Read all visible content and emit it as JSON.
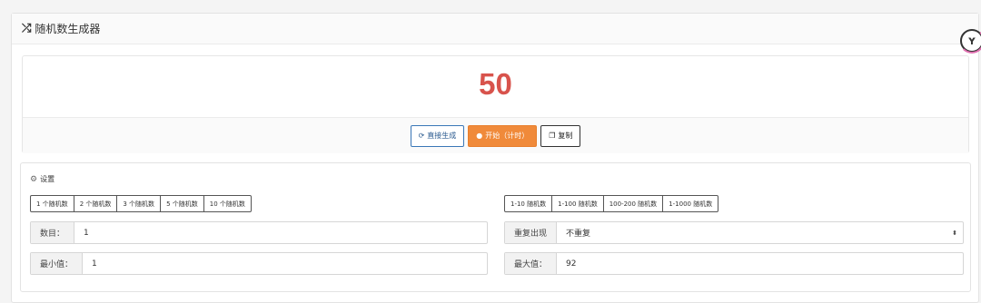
{
  "panel": {
    "title": "随机数生成器",
    "icon": "shuffle-icon"
  },
  "result": {
    "value": "50"
  },
  "actions": {
    "direct_label": "直接生成",
    "start_label": "开始（计时）",
    "copy_label": "复制",
    "direct_icon": "refresh-icon",
    "start_icon": "info-icon",
    "copy_icon": "copy-icon"
  },
  "settings": {
    "title": "设置",
    "icon": "user-settings-icon",
    "count_presets": [
      "1 个随机数",
      "2 个随机数",
      "3 个随机数",
      "5 个随机数",
      "10 个随机数"
    ],
    "range_presets": [
      "1-10 随机数",
      "1-100 随机数",
      "100-200 随机数",
      "1-1000 随机数"
    ],
    "count_label": "数目：",
    "count_value": "1",
    "repeat_label": "重复出现",
    "repeat_value": "不重复",
    "min_label": "最小值：",
    "min_value": "1",
    "max_label": "最大值：",
    "max_value": "92"
  },
  "colors": {
    "result": "#d8534c",
    "primary_button": "#f08a3a",
    "outline_blue": "#3a77b7"
  }
}
